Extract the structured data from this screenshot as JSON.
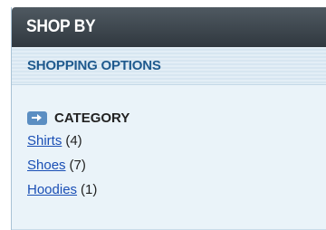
{
  "panel": {
    "title": "SHOP BY"
  },
  "options": {
    "title": "SHOPPING OPTIONS"
  },
  "category": {
    "icon": "arrow-right-icon",
    "title": "CATEGORY",
    "items": [
      {
        "label": "Shirts",
        "count": "(4)"
      },
      {
        "label": "Shoes",
        "count": "(7)"
      },
      {
        "label": "Hoodies",
        "count": "(1)"
      }
    ]
  },
  "colors": {
    "header_dark": "#30383f",
    "subheader_text": "#1f5a8e",
    "link": "#1a4fb5",
    "icon_bg": "#5b8ec2"
  }
}
